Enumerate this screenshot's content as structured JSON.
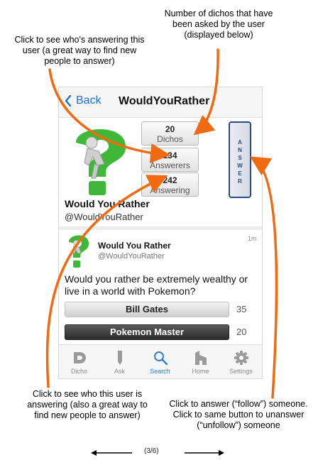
{
  "annotations": {
    "dichos_note": "Number of dichos that have been asked by the user (displayed below)",
    "answerers_note": "Click to see who's answering this user (a great way to find new people to answer)",
    "answering_note": "Click to see who this user is answering (also a great way to find new people to answer)",
    "answer_note": "Click to answer (“follow”) someone. Click to same button to unanswer (“unfollow”) someone",
    "arrow_color": "#f26a0f"
  },
  "navbar": {
    "back_label": "Back",
    "title": "WouldYouRather"
  },
  "stats": {
    "dichos": {
      "value": "20",
      "label": "Dichos"
    },
    "answerers": {
      "value": "134",
      "label": "Answerers"
    },
    "answering": {
      "value": "242",
      "label": "Answering"
    }
  },
  "answer_button": {
    "label": "ANSWER",
    "letters": [
      "A",
      "N",
      "S",
      "W",
      "E",
      "R"
    ]
  },
  "profile": {
    "name": "Would You Rather",
    "handle": "@WouldYouRather"
  },
  "dicho": {
    "author_name": "Would You Rather",
    "author_handle": "@WouldYouRather",
    "time": "1m",
    "question": "Would you rather be extremely wealthy or live in a world with Pokemon?",
    "choices": [
      {
        "label": "Bill Gates",
        "count": "35"
      },
      {
        "label": "Pokemon Master",
        "count": "20"
      }
    ]
  },
  "tabbar": {
    "tabs": [
      {
        "label": "Dicho",
        "icon": "dicho-logo-icon"
      },
      {
        "label": "Ask",
        "icon": "pencil-icon"
      },
      {
        "label": "Search",
        "icon": "search-icon",
        "active": true
      },
      {
        "label": "Home",
        "icon": "home-icon"
      },
      {
        "label": "Settings",
        "icon": "gear-icon"
      }
    ]
  },
  "pager": {
    "page_label": "(3/6)"
  },
  "colors": {
    "accent_blue": "#2f7ee0",
    "answer_border": "#2b4a86",
    "annotation_orange": "#f26a0f"
  }
}
